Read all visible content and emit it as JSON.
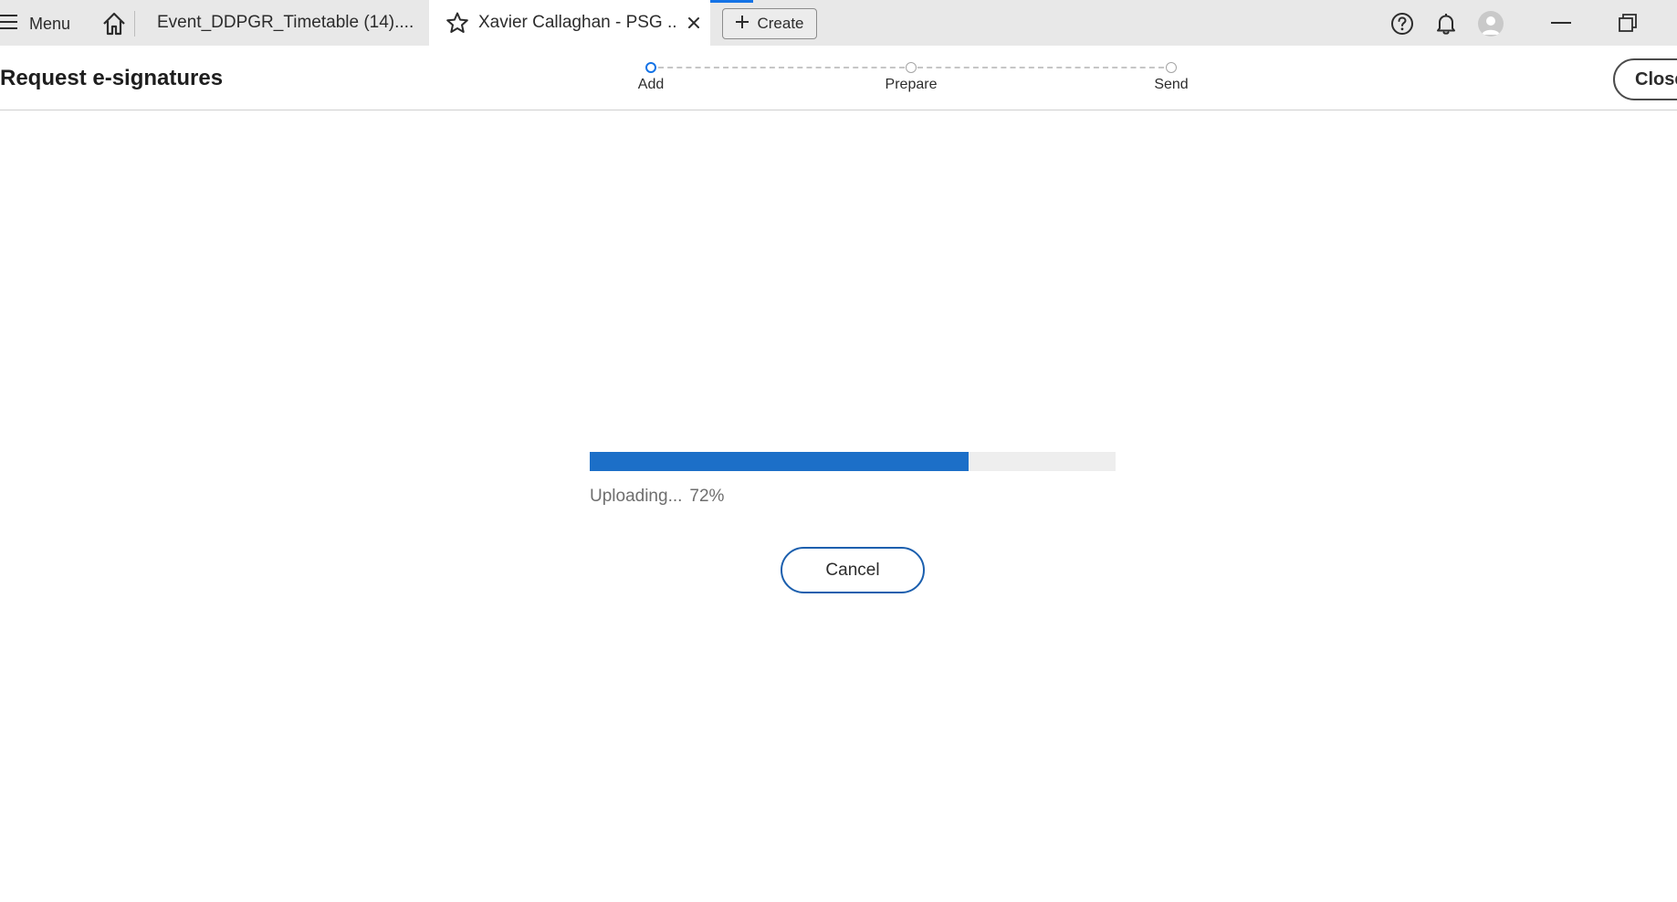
{
  "tabbar": {
    "menu_label": "Menu",
    "doc_tab_label": "Event_DDPGR_Timetable (14)....",
    "active_tab_label": "Xavier Callaghan - PSG ...",
    "create_label": "Create",
    "icons": {
      "menu": "hamburger-icon",
      "home": "home-icon",
      "star": "star-icon",
      "close": "close-icon",
      "plus": "plus-icon",
      "help": "help-icon",
      "bell": "bell-icon",
      "avatar": "avatar-icon",
      "minimize": "minimize-icon",
      "restore": "restore-icon"
    }
  },
  "header": {
    "title": "Request e-signatures",
    "close_label": "Close",
    "steps": [
      {
        "label": "Add",
        "active": true
      },
      {
        "label": "Prepare",
        "active": false
      },
      {
        "label": "Send",
        "active": false
      }
    ]
  },
  "upload": {
    "status_text": "Uploading...",
    "percent_text": "72%",
    "progress": 0.72,
    "cancel_label": "Cancel"
  },
  "colors": {
    "accent": "#1473e6",
    "progress_fill": "#1c6fc8",
    "cancel_border": "#1b5fae"
  }
}
